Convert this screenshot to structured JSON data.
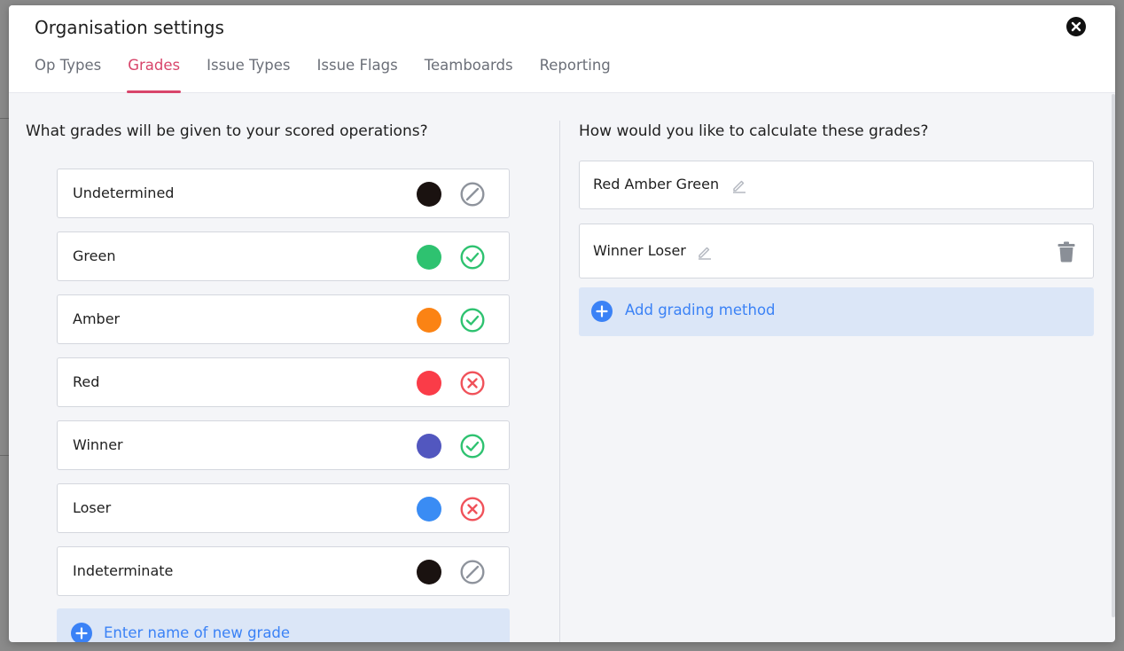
{
  "modal": {
    "title": "Organisation settings",
    "close_icon": "close-icon"
  },
  "tabs": [
    {
      "label": "Op Types",
      "active": false
    },
    {
      "label": "Grades",
      "active": true
    },
    {
      "label": "Issue Types",
      "active": false
    },
    {
      "label": "Issue Flags",
      "active": false
    },
    {
      "label": "Teamboards",
      "active": false
    },
    {
      "label": "Reporting",
      "active": false
    }
  ],
  "grades": {
    "question": "What grades will be given to your scored operations?",
    "items": [
      {
        "label": "Undetermined",
        "color": "#1a1210",
        "status": "neutral"
      },
      {
        "label": "Green",
        "color": "#2ec270",
        "status": "pass"
      },
      {
        "label": "Amber",
        "color": "#fb8314",
        "status": "pass"
      },
      {
        "label": "Red",
        "color": "#fa3c48",
        "status": "fail"
      },
      {
        "label": "Winner",
        "color": "#5257bf",
        "status": "pass"
      },
      {
        "label": "Loser",
        "color": "#3a8cf4",
        "status": "fail"
      },
      {
        "label": "Indeterminate",
        "color": "#1a1210",
        "status": "neutral"
      }
    ],
    "new_grade_placeholder": "Enter name of new grade"
  },
  "methods": {
    "question": "How would you like to calculate these grades?",
    "items": [
      {
        "label": "Red Amber Green",
        "deletable": false
      },
      {
        "label": "Winner Loser",
        "deletable": true
      }
    ],
    "add_label": "Add grading method"
  },
  "colors": {
    "accent": "#d8456b",
    "link": "#3b82f6",
    "pass": "#2ec270",
    "fail": "#f0525a",
    "neutral": "#8e939c"
  }
}
